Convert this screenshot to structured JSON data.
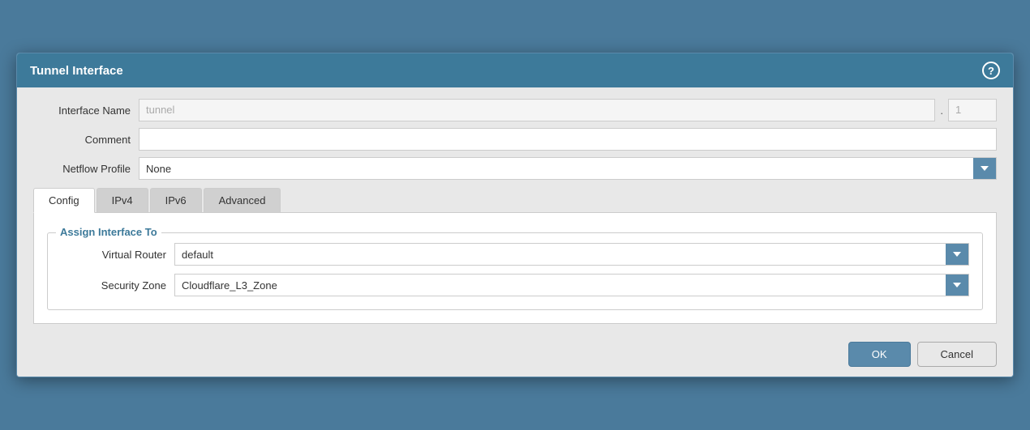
{
  "dialog": {
    "title": "Tunnel Interface",
    "help_icon": "?"
  },
  "form": {
    "interface_name_label": "Interface Name",
    "interface_name_placeholder": "tunnel",
    "interface_name_number": "1",
    "comment_label": "Comment",
    "comment_value": "",
    "netflow_profile_label": "Netflow Profile",
    "netflow_profile_value": "None"
  },
  "tabs": [
    {
      "id": "config",
      "label": "Config",
      "active": true
    },
    {
      "id": "ipv4",
      "label": "IPv4",
      "active": false
    },
    {
      "id": "ipv6",
      "label": "IPv6",
      "active": false
    },
    {
      "id": "advanced",
      "label": "Advanced",
      "active": false
    }
  ],
  "config_tab": {
    "section_title": "Assign Interface To",
    "virtual_router_label": "Virtual Router",
    "virtual_router_value": "default",
    "security_zone_label": "Security Zone",
    "security_zone_value": "Cloudflare_L3_Zone"
  },
  "footer": {
    "ok_label": "OK",
    "cancel_label": "Cancel"
  }
}
